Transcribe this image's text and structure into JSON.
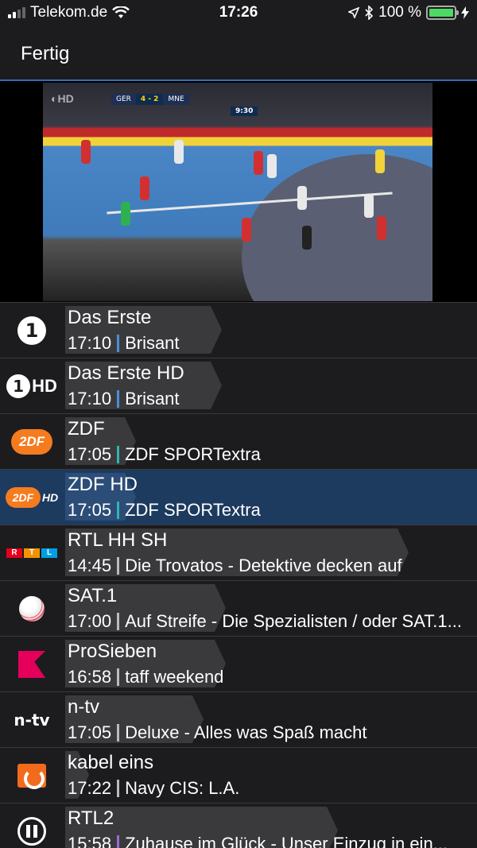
{
  "status_bar": {
    "carrier": "Telekom.de",
    "time": "17:26",
    "battery_percent": "100 %",
    "battery_level": 1.0
  },
  "nav": {
    "done_label": "Fertig"
  },
  "video": {
    "score_team1": "GER",
    "score_value": "4 - 2",
    "score_team2": "MNE",
    "clock": "9:30"
  },
  "channels": [
    {
      "name": "Das Erste",
      "time": "17:10",
      "show": "Brisant",
      "progress": 0.42,
      "accent": "#4a8fd6",
      "logo": "ard-logo"
    },
    {
      "name": "Das Erste HD",
      "time": "17:10",
      "show": "Brisant",
      "progress": 0.42,
      "accent": "#4a8fd6",
      "logo": "ard-hd-logo"
    },
    {
      "name": "ZDF",
      "time": "17:05",
      "show": "ZDF SPORTextra",
      "progress": 0.19,
      "accent": "#2fb5b0",
      "logo": "zdf-logo"
    },
    {
      "name": "ZDF HD",
      "time": "17:05",
      "show": "ZDF SPORTextra",
      "progress": 0.19,
      "accent": "#2fb5b0",
      "logo": "zdf-hd-logo"
    },
    {
      "name": "RTL HH SH",
      "time": "14:45",
      "show": "Die Trovatos - Detektive decken auf",
      "progress": 0.92,
      "accent": "#bbbbbb",
      "logo": "rtl-logo"
    },
    {
      "name": "SAT.1",
      "time": "17:00",
      "show": "Auf Streife - Die Spezialisten / oder SAT.1...",
      "progress": 0.43,
      "accent": "#bbbbbb",
      "logo": "sat1-logo"
    },
    {
      "name": "ProSieben",
      "time": "16:58",
      "show": "taff weekend",
      "progress": 0.43,
      "accent": "#bbbbbb",
      "logo": "prosieben-logo"
    },
    {
      "name": "n-tv",
      "time": "17:05",
      "show": "Deluxe - Alles was Spaß macht",
      "progress": 0.37,
      "accent": "#bbbbbb",
      "logo": "ntv-logo"
    },
    {
      "name": "kabel eins",
      "time": "17:22",
      "show": "Navy CIS: L.A.",
      "progress": 0.06,
      "accent": "#bbbbbb",
      "logo": "kabeleins-logo"
    },
    {
      "name": "RTL2",
      "time": "15:58",
      "show": "Zuhause im Glück - Unser Einzug in ein...",
      "progress": 0.73,
      "accent": "#9c6ad6",
      "logo": "rtl2-logo"
    }
  ],
  "selected_index": 3
}
